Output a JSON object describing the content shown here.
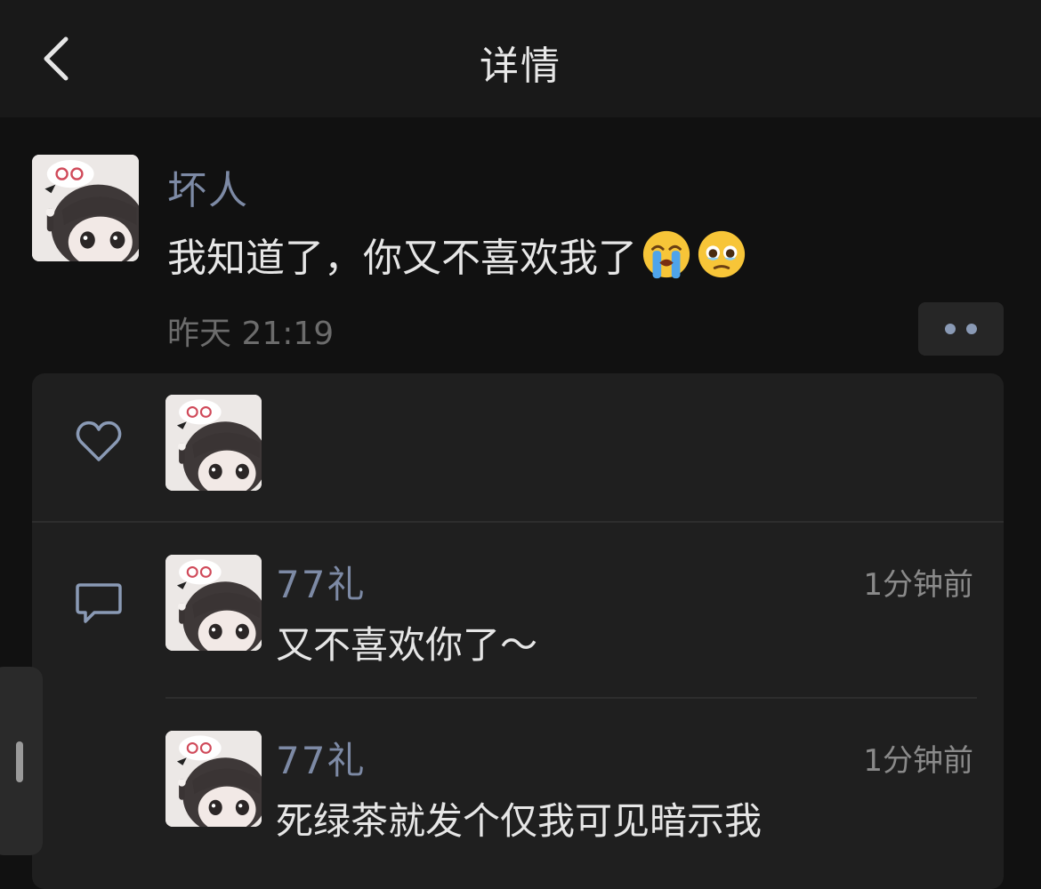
{
  "header": {
    "title": "详情",
    "back_icon": "chevron-left-icon"
  },
  "post": {
    "author": "坏人",
    "text": "我知道了，你又不喜欢我了",
    "emojis": [
      "loudly-crying-face-emoji",
      "face-holding-back-tears-emoji"
    ],
    "time": "昨天 21:19",
    "more_icon": "more-dots-icon"
  },
  "likes": {
    "icon": "heart-outline-icon",
    "count": 1
  },
  "comments": {
    "icon": "comment-bubble-icon",
    "items": [
      {
        "name": "77礼",
        "time": "1分钟前",
        "text": "又不喜欢你了～"
      },
      {
        "name": "77礼",
        "time": "1分钟前",
        "text": "死绿茶就发个仅我可见暗示我"
      }
    ]
  },
  "colors": {
    "name": "#7d8aa5",
    "background": "#111111",
    "panel": "#1f1f1f",
    "navbar": "#191919"
  }
}
